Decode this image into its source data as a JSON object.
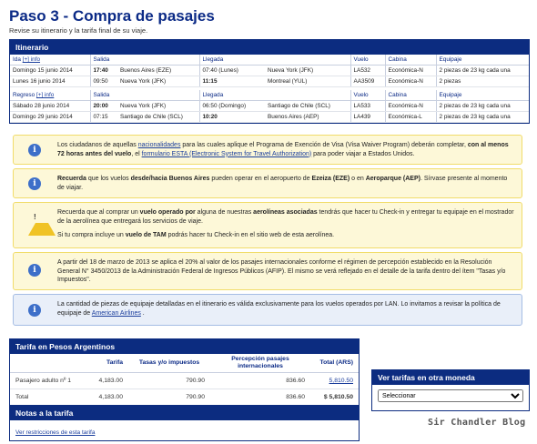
{
  "page": {
    "title": "Paso 3 - Compra de pasajes",
    "subtitle": "Revise su itinerario y la tarifa final de su viaje."
  },
  "itinerary": {
    "heading": "Itinerario",
    "columns": {
      "salida": "Salida",
      "llegada": "Llegada",
      "vuelo": "Vuelo",
      "cabina": "Cabina",
      "equipaje": "Equipaje"
    },
    "outbound": {
      "label": "Ida",
      "info_link": "[+] info",
      "rows": [
        {
          "date": "Domingo 15 junio 2014",
          "dep_time": "17:40",
          "dep_place": "Buenos Aires (EZE)",
          "arr_time": "07:40 (Lunes)",
          "arr_place": "Nueva York (JFK)",
          "flight": "LA532",
          "cabin": "Económica-N",
          "baggage": "2 piezas de 23 kg cada una"
        },
        {
          "date": "Lunes 16 junio 2014",
          "dep_time": "09:50",
          "dep_place": "Nueva York (JFK)",
          "arr_time": "11:15",
          "arr_place": "Montreal (YUL)",
          "flight": "AA3509",
          "cabin": "Económica-N",
          "baggage": "2 piezas"
        }
      ]
    },
    "return": {
      "label": "Regreso",
      "info_link": "[+] info",
      "rows": [
        {
          "date": "Sábado 28 junio 2014",
          "dep_time": "20:00",
          "dep_place": "Nueva York (JFK)",
          "arr_time": "06:50 (Domingo)",
          "arr_place": "Santiago de Chile (SCL)",
          "flight": "LA533",
          "cabin": "Económica-N",
          "baggage": "2 piezas de 23 kg cada una"
        },
        {
          "date": "Domingo 29 junio 2014",
          "dep_time": "07:15",
          "dep_place": "Santiago de Chile (SCL)",
          "arr_time": "10:20",
          "arr_place": "Buenos Aires (AEP)",
          "flight": "LA439",
          "cabin": "Económica-L",
          "baggage": "2 piezas de 23 kg cada una"
        }
      ]
    }
  },
  "notices": {
    "n1": {
      "icon": "info-icon",
      "t1": "Los ciudadanos de aquellas ",
      "link1": "nacionalidades",
      "t2": " para las cuales aplique el Programa de Exención de Visa (Visa Waiver Program) deberán completar, ",
      "b1": "con al menos 72 horas antes del vuelo",
      "t3": ", el ",
      "link2": "formulario ESTA (Electronic System for Travel Authorization)",
      "t4": " para poder viajar a Estados Unidos."
    },
    "n2": {
      "icon": "info-icon",
      "b1": "Recuerda",
      "t1": " que los vuelos ",
      "b2": "desde/hacia Buenos Aires",
      "t2": " pueden operar en el aeropuerto de ",
      "b3": "Ezeiza (EZE)",
      "t3": " o en ",
      "b4": "Aeroparque (AEP)",
      "t4": ". Sírvase presente al momento de viajar."
    },
    "n3": {
      "icon": "warning-icon",
      "t1": "Recuerda que al comprar un ",
      "b1": "vuelo operado por",
      "t2": " alguna de nuestras ",
      "b2": "aerolíneas asociadas",
      "t3": " tendrás que hacer tu Check-in y entregar tu equipaje en el mostrador de la aerolínea que entregará los servicios de viaje.",
      "t4": "Si tu compra incluye un ",
      "b3": "vuelo de TAM",
      "t5": " podrás hacer tu Check-in en el sitio web de esta aerolínea."
    },
    "n4": {
      "icon": "info-icon",
      "text": "A partir del 18 de marzo de 2013 se aplica el 20% al valor de los pasajes internacionales conforme el régimen de percepción establecido en la Resolución General N° 3450/2013 de la Administración Federal de Ingresos Públicos (AFIP). El mismo se verá reflejado en el detalle de la tarifa dentro del ítem \"Tasas y/o Impuestos\"."
    },
    "n5": {
      "t1": "La cantidad de piezas de equipaje detalladas en el itinerario es válida exclusivamente para los vuelos operados por LAN. Lo invitamos a revisar la política de equipaje de ",
      "link1": "American Airlines",
      "t2": " ."
    }
  },
  "fare": {
    "heading": "Tarifa en Pesos Argentinos",
    "columns": {
      "tarifa": "Tarifa",
      "tasas": "Tasas y/o impuestos",
      "percepcion": "Percepción pasajes internacionales",
      "total": "Total (ARS)"
    },
    "rows": [
      {
        "label": "Pasajero adulto nº 1",
        "tarifa": "4,183.00",
        "tasas": "790.90",
        "percepcion": "836.60",
        "total": "5,810.50"
      },
      {
        "label": "Total",
        "tarifa": "4,183.00",
        "tasas": "790.90",
        "percepcion": "836.60",
        "total": "$ 5,810.50"
      }
    ]
  },
  "notes": {
    "heading": "Notas a la tarifa",
    "link": "Ver restricciones de esta tarifa"
  },
  "currency": {
    "heading": "Ver tarifas en otra moneda",
    "selected": "Seleccionar"
  },
  "watermark": "Sir Chandler Blog",
  "colors": {
    "brand": "#0c2c80",
    "notice_yellow": "#fdf8d8",
    "notice_blue": "#e9eff9",
    "link": "#1a3d9c"
  }
}
